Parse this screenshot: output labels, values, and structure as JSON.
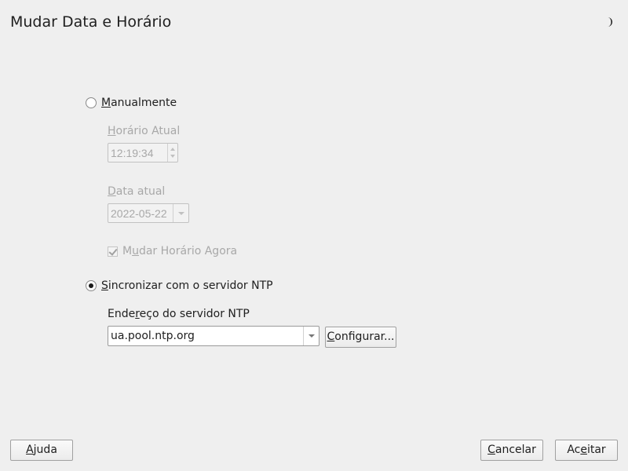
{
  "window": {
    "title": "Mudar Data e Horário",
    "theme_icon": "half-moon-icon"
  },
  "manual": {
    "radio_label_first": "M",
    "radio_label_rest": "anualmente",
    "selected": false,
    "time_label_first": "H",
    "time_label_rest": "orário Atual",
    "time_value": "12:19:34",
    "date_label_first": "D",
    "date_label_rest": "ata atual",
    "date_value": "2022-05-22",
    "change_now_pre": "M",
    "change_now_u": "u",
    "change_now_rest": "dar Horário Agora",
    "change_now_checked": true
  },
  "ntp": {
    "radio_label_first": "S",
    "radio_label_rest": "incronizar com o servidor NTP",
    "selected": true,
    "address_label_pre": "Ende",
    "address_label_u": "r",
    "address_label_rest": "eço do servidor NTP",
    "address_value": "ua.pool.ntp.org",
    "configure_first": "C",
    "configure_rest": "onfigurar..."
  },
  "footer": {
    "help_first": "A",
    "help_rest": "juda",
    "cancel_first": "C",
    "cancel_rest": "ancelar",
    "accept_pre": "Ac",
    "accept_u": "e",
    "accept_rest": "itar"
  }
}
